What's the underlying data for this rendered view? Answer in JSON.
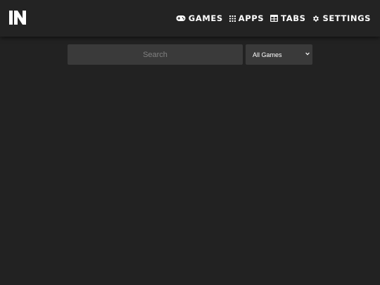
{
  "header": {
    "logo_text": "IN",
    "nav": [
      {
        "label": "GAMES",
        "icon": "gamepad-icon"
      },
      {
        "label": "APPS",
        "icon": "grid-dots-icon"
      },
      {
        "label": "TABS",
        "icon": "table-icon"
      },
      {
        "label": "SETTINGS",
        "icon": "gear-icon"
      }
    ]
  },
  "search": {
    "placeholder": "Search",
    "value": ""
  },
  "filter": {
    "selected": "All Games"
  },
  "colors": {
    "background": "#222222",
    "topbar": "#232323",
    "field": "#3a3a3a",
    "text": "#ffffff"
  }
}
